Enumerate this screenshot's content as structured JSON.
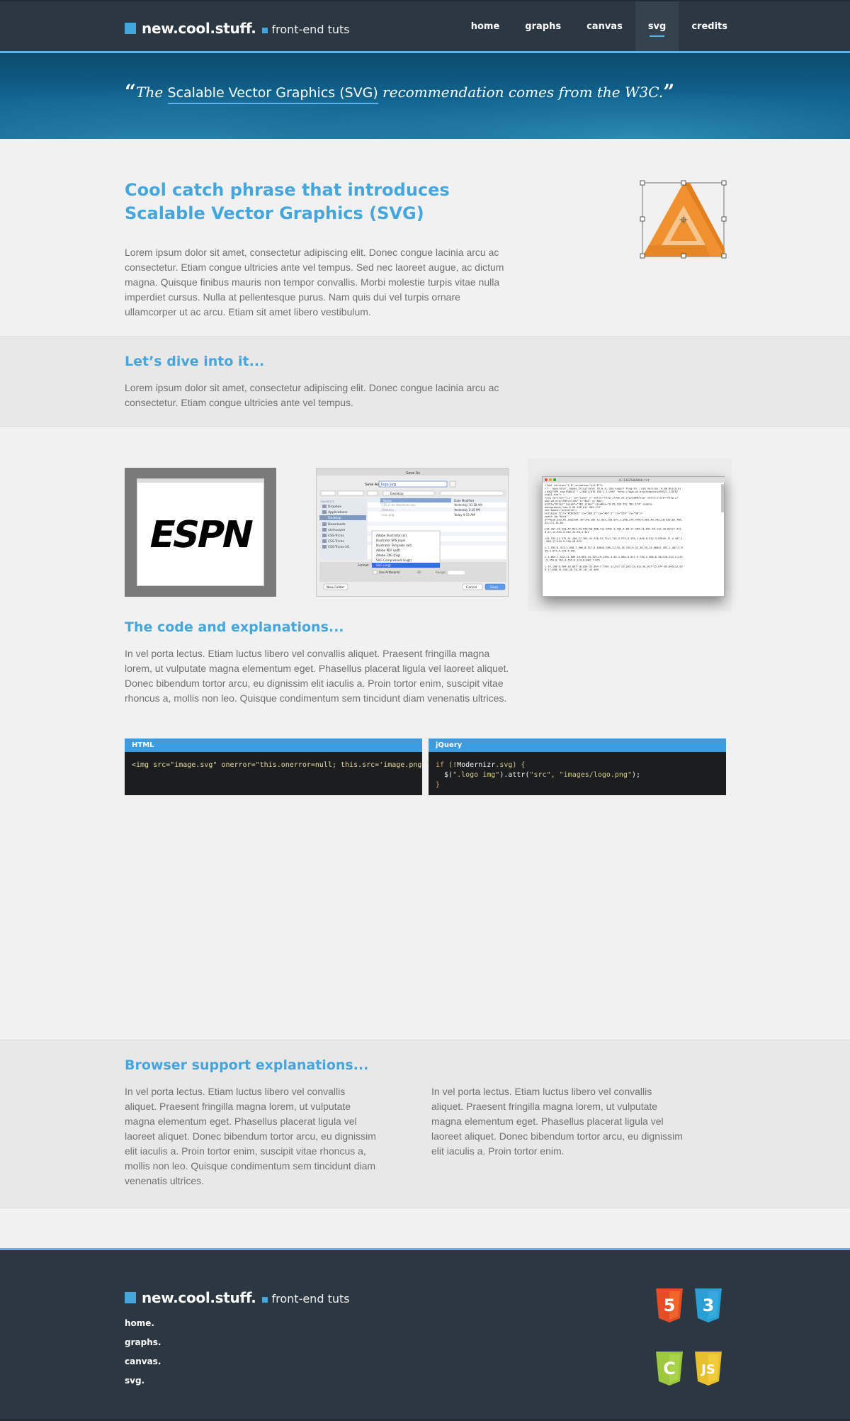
{
  "header": {
    "brand_name": "new.cool.stuff.",
    "brand_tagline": "front-end tuts",
    "nav": [
      {
        "label": "home"
      },
      {
        "label": "graphs"
      },
      {
        "label": "canvas"
      },
      {
        "label": "svg",
        "active": true
      },
      {
        "label": "credits"
      }
    ]
  },
  "banner": {
    "open_quote": "“",
    "pre": "The ",
    "highlight": "Scalable Vector Graphics (SVG)",
    "post": " recommendation comes from the W3C.",
    "close_quote": "”"
  },
  "intro": {
    "heading_line1": "Cool catch phrase that introduces",
    "heading_line2": "Scalable Vector Graphics (SVG)",
    "paragraph": "Lorem ipsum dolor sit amet, consectetur adipiscing elit. Donec congue lacinia arcu ac consectetur. Etiam congue ultricies ante vel tempus. Sed nec laoreet augue, ac dictum magna. Quisque finibus mauris non tempor convallis. Morbi molestie turpis vitae nulla imperdiet cursus. Nulla at pellentesque purus. Nam quis dui vel turpis ornare ullamcorper ut ac arcu. Etiam sit amet libero vestibulum."
  },
  "dive": {
    "heading": "Let’s dive into it...",
    "paragraph": "Lorem ipsum dolor sit amet, consectetur adipiscing elit. Donec congue lacinia arcu ac consectetur. Etiam congue ultricies ante vel tempus."
  },
  "screens": {
    "espn_logo": "ESPN",
    "save_dialog": {
      "title": "Save As",
      "save_as_label": "Save As:",
      "save_as_value": "logo.svg",
      "location": "Desktop",
      "sidebar_header": "FAVORITES",
      "sidebar": [
        "Dropbox",
        "Applications",
        "Desktop",
        "Downloads",
        "chriscoyier",
        "CSS-Tricks",
        "CSS-Tricks",
        "CSS-Tricks-10"
      ],
      "col_name": "Name",
      "col_date": "Date Modified",
      "files": [
        {
          "name": "CSS is for Machines.key",
          "date": "Yesterday 10:18 AM"
        },
        {
          "name": "Statutes",
          "date": "Yesterday 2:10 PM"
        },
        {
          "name": "icon.png",
          "date": "Today 9:15 AM"
        }
      ],
      "formats": [
        "Adobe Illustrator (ai)",
        "Illustrator EPS (eps)",
        "Illustrator Template (ait)",
        "Adobe PDF (pdf)",
        "Adobe FXG (fxg)",
        "SVG Compressed (svgz)",
        "SVG (svg)"
      ],
      "format_label": "Format:",
      "use_artboards": "Use Artboards",
      "all": "All",
      "range": "Range:",
      "new_folder": "New Folder",
      "cancel": "Cancel",
      "save": "Save"
    },
    "svg_source": {
      "title": "all13625004860.txt",
      "lines": [
        "<?xml version=\"1.0\" encoding=\"utf-8\"?>",
        "<!-- Generator: Adobe Illustrator 16.0.4, SVG Export Plug-In . SVG Version: 6.00 Build 0)",
        "<!DOCTYPE svg PUBLIC \"-//W3C//DTD SVG 1.1//EN\" \"http://www.w3.org/Graphics/SVG/1.1/DTD/",
        "svg11.dtd\">",
        "<svg version=\"1.1\" id=\"Layer_1\" xmlns=\"http://www.w3.org/2000/svg\" xmlns:xlink=\"http://",
        "www.w3.org/1999/xlink\" x=\"0px\" y=\"0px\"",
        "     width=\"612px\" height=\"582.174px\" viewBox=\"0 65.326 612 582.174\" enable-",
        "background=\"new 0 65.326 612 582.174\"",
        "     xml:space=\"preserve\">",
        "<ellipse fill=\"#C6C6C6\" cx=\"283.5\" cy=\"467.5\" rx=\"259\" ry=\"98\"/>",
        "<path id=\"bird\"",
        "d=\"M210.333,61.333C184.367,66.105-12.501,158.637,1.058,276.449c4.383,40.392,18.533,63.786,",
        "52.171,70.83",
        "",
        "c36.307,16.544,57.822,54.556,50.486,112.954c-9.935,4.88-17.485,11.831-26.112,20.815c7.531-",
        "0.17,14.943-0.312,22.56,4.341",
        "",
        "c26.333,12.375,31.296,27.363,42.976,51.72c1.714,3.572,8.192,2.849,8.312-3.878c0.17-4.467-1",
        ".058-17.454-5.226-26.633",
        "",
        "c-2.955-8.313,3.058-7.905,8.917-6.186c8.396,3.115,16.334,9.43,30.59,13.868c5.392,1.487,5.9",
        "95-3.877,5.224-6.991",
        "",
        "c-1.864-7.522-11.009-18.862-24.319-19.229c-4.82-2.084-0.927-9.736,5.568-8.351C28.224,2.415",
        ",5.359,8.762,4.555-6.114,8.082-7.875",
        "",
        "c-14.198-6.904-28.867-18.858-53.864-7.799c-11.617-29.265-29.811-81.617-15.674-85.845c12.63",
        "9-17.638,31.218-28.74,39.147-43.409"
      ]
    }
  },
  "code_section": {
    "heading": "The code and explanations...",
    "paragraph": "In vel porta lectus. Etiam luctus libero vel convallis aliquet. Praesent fringilla magna lorem, ut vulputate magna elementum eget. Phasellus placerat ligula vel laoreet aliquet. Donec bibendum tortor arcu, eu dignissim elit iaculis a. Proin tortor enim, suscipit vitae rhoncus a, mollis non leo. Quisque condimentum sem tincidunt diam venenatis ultrices.",
    "html_box": {
      "title": "HTML",
      "code": "<img src=\"image.svg\" onerror=\"this.onerror=null; this.src='image.png'\">"
    },
    "jquery_box": {
      "title": "jQuery",
      "line1_kw": "if",
      "line1_a": " (!",
      "line1_b": "Modernizr",
      "line1_c": ".svg) {",
      "line2_a": "  $(",
      "line2_b": "\".logo img\"",
      "line2_c": ").attr(",
      "line2_d": "\"src\", \"images/logo.png\"",
      "line2_e": ");",
      "line3": "}"
    }
  },
  "support": {
    "heading": "Browser support explanations...",
    "col1": "In vel porta lectus. Etiam luctus libero vel convallis aliquet. Praesent fringilla magna lorem, ut vulputate magna elementum eget. Phasellus placerat ligula vel laoreet aliquet. Donec bibendum tortor arcu, eu dignissim elit iaculis a. Proin tortor enim, suscipit vitae rhoncus a, mollis non leo. Quisque condimentum sem tincidunt diam venenatis ultrices.",
    "col2": "In vel porta lectus. Etiam luctus libero vel convallis aliquet. Praesent fringilla magna lorem, ut vulputate magna elementum eget. Phasellus placerat ligula vel laoreet aliquet. Donec bibendum tortor arcu, eu dignissim elit iaculis a. Proin tortor enim."
  },
  "footer": {
    "brand_name": "new.cool.stuff.",
    "brand_tagline": "front-end tuts",
    "links": [
      "home.",
      "graphs.",
      "canvas.",
      "svg."
    ],
    "badges": [
      {
        "icon": "html5-icon",
        "glyph": "5",
        "color": "#e44d26"
      },
      {
        "icon": "css3-icon",
        "glyph": "3",
        "color": "#2a9fd6"
      },
      {
        "icon": "canvas-icon",
        "glyph": "C",
        "color": "#9bc83c"
      },
      {
        "icon": "javascript-icon",
        "glyph": "JS",
        "color": "#e6c12d"
      }
    ]
  },
  "colors": {
    "accent": "#44a6dc",
    "header_bg": "#2b3741",
    "code_header": "#3d9be0",
    "svg_logo_orange": "#f0912f"
  }
}
